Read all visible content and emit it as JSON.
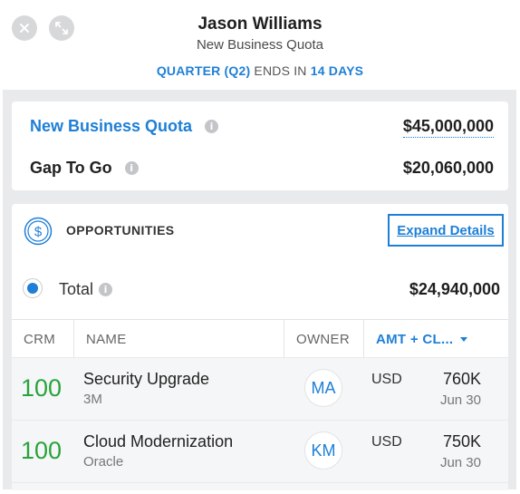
{
  "header": {
    "name": "Jason Williams",
    "subtitle": "New Business Quota",
    "quarter_prefix": "QUARTER (Q2)",
    "quarter_mid": "ENDS IN",
    "quarter_days": "14 DAYS"
  },
  "quota": {
    "label": "New Business Quota",
    "amount": "$45,000,000",
    "gap_label": "Gap To Go",
    "gap_amount": "$20,060,000"
  },
  "opportunities": {
    "title": "OPPORTUNITIES",
    "expand_label": "Expand Details",
    "total_label": "Total",
    "total_amount": "$24,940,000",
    "columns": [
      "CRM",
      "NAME",
      "OWNER",
      "AMT + CL..."
    ],
    "rows": [
      {
        "crm": "100",
        "name": "Security Upgrade",
        "account": "3M",
        "owner": "MA",
        "currency": "USD",
        "amount": "760K",
        "date": "Jun 30"
      },
      {
        "crm": "100",
        "name": "Cloud Modernization",
        "account": "Oracle",
        "owner": "KM",
        "currency": "USD",
        "amount": "750K",
        "date": "Jun 30"
      }
    ]
  },
  "colors": {
    "accent": "#1e7fd6",
    "crm_green": "#2aa33c",
    "panel_gray": "#e9eaec"
  },
  "icons": [
    "close-icon",
    "expand-icon",
    "info-icon",
    "dollar-coin-icon",
    "sort-down-icon"
  ]
}
